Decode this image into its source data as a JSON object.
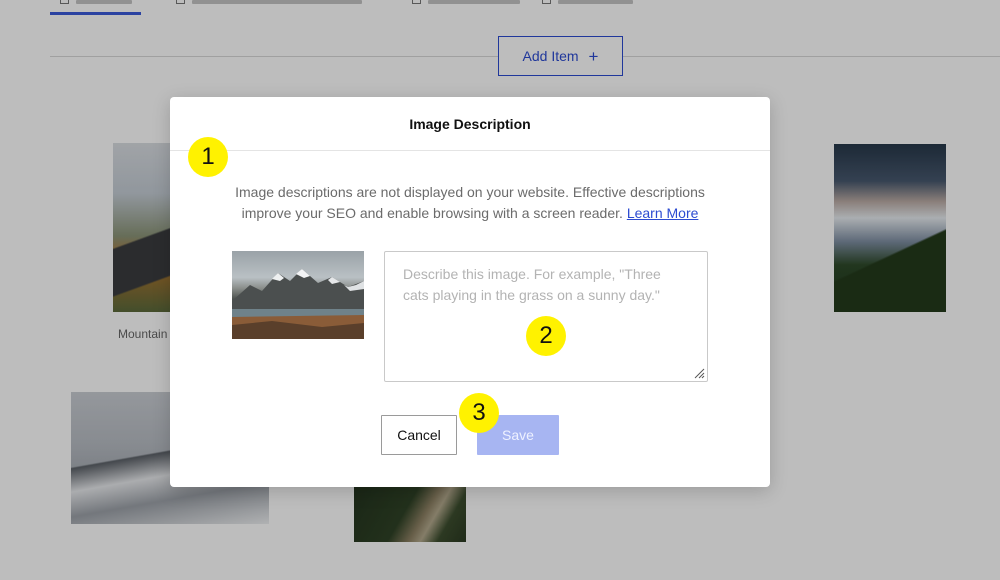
{
  "toolbar": {
    "add_item_label": "Add Item",
    "add_item_icon": "plus-icon"
  },
  "gallery": {
    "tile_label": "Mountain"
  },
  "modal": {
    "title": "Image Description",
    "body_text": "Image descriptions are not displayed on your website. Effective descriptions improve your SEO and enable browsing with a screen reader.",
    "learn_more_label": "Learn More",
    "textarea_placeholder": "Describe this image. For example, \"Three cats playing in the grass on a sunny day.\"",
    "textarea_value": "",
    "cancel_label": "Cancel",
    "save_label": "Save"
  },
  "markers": [
    "1",
    "2",
    "3"
  ],
  "colors": {
    "accent": "#2c4bd1",
    "save_disabled": "#a7b5f2",
    "marker": "#fff200",
    "overlay": "rgba(0,0,0,0.26)"
  }
}
